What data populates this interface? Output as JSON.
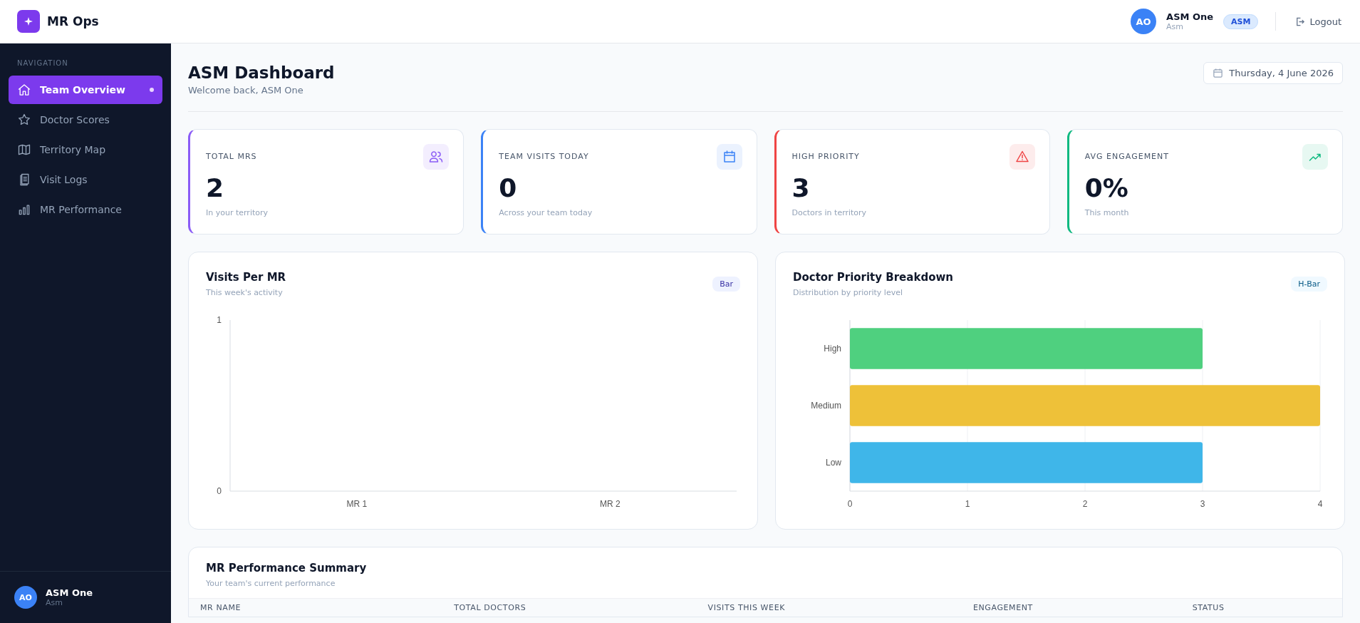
{
  "brand": {
    "name": "MR Ops"
  },
  "topbar": {
    "avatar": "AO",
    "user_name": "ASM One",
    "user_role": "Asm",
    "role_badge": "ASM",
    "logout": "Logout"
  },
  "sidebar": {
    "section_label": "NAVIGATION",
    "items": [
      {
        "label": "Team Overview",
        "selected": true
      },
      {
        "label": "Doctor Scores",
        "selected": false
      },
      {
        "label": "Territory Map",
        "selected": false
      },
      {
        "label": "Visit Logs",
        "selected": false
      },
      {
        "label": "MR Performance",
        "selected": false
      }
    ],
    "user": {
      "avatar": "AO",
      "name": "ASM One",
      "role": "Asm"
    }
  },
  "page": {
    "title": "ASM Dashboard",
    "subtitle": "Welcome back, ASM One",
    "date": "Thursday, 4 June 2026"
  },
  "stats": [
    {
      "label": "TOTAL MRS",
      "value": "2",
      "note": "In your territory",
      "color": "#8b5cf6"
    },
    {
      "label": "TEAM VISITS TODAY",
      "value": "0",
      "note": "Across your team today",
      "color": "#3b82f6"
    },
    {
      "label": "HIGH PRIORITY",
      "value": "3",
      "note": "Doctors in territory",
      "color": "#ef4444"
    },
    {
      "label": "AVG ENGAGEMENT",
      "value": "0%",
      "note": "This month",
      "color": "#10b981"
    }
  ],
  "charts": [
    {
      "title": "Visits Per MR",
      "subtitle": "This week's activity",
      "badge": "Bar",
      "chart_data": {
        "type": "bar",
        "categories": [
          "MR 1",
          "MR 2"
        ],
        "values": [
          0,
          0
        ],
        "ylim": [
          0,
          1
        ],
        "yticks": [
          0,
          1
        ]
      }
    },
    {
      "title": "Doctor Priority Breakdown",
      "subtitle": "Distribution by priority level",
      "badge": "H-Bar",
      "chart_data": {
        "type": "bar",
        "orientation": "horizontal",
        "stacked": true,
        "grid": true,
        "categories": [
          "High",
          "Medium",
          "Low"
        ],
        "xlim": [
          0,
          4
        ],
        "xticks": [
          0,
          1,
          2,
          3,
          4
        ],
        "series": [
          {
            "color": "#4fd07f",
            "values": [
              3,
              null,
              null
            ]
          },
          {
            "color": "#eec139",
            "values": [
              null,
              4,
              null
            ]
          },
          {
            "color": "#3fb6e9",
            "values": [
              null,
              null,
              3
            ]
          }
        ]
      }
    }
  ],
  "summary": {
    "title": "MR Performance Summary",
    "subtitle": "Your team's current performance",
    "columns": [
      "MR NAME",
      "TOTAL DOCTORS",
      "VISITS THIS WEEK",
      "ENGAGEMENT",
      "STATUS"
    ]
  }
}
